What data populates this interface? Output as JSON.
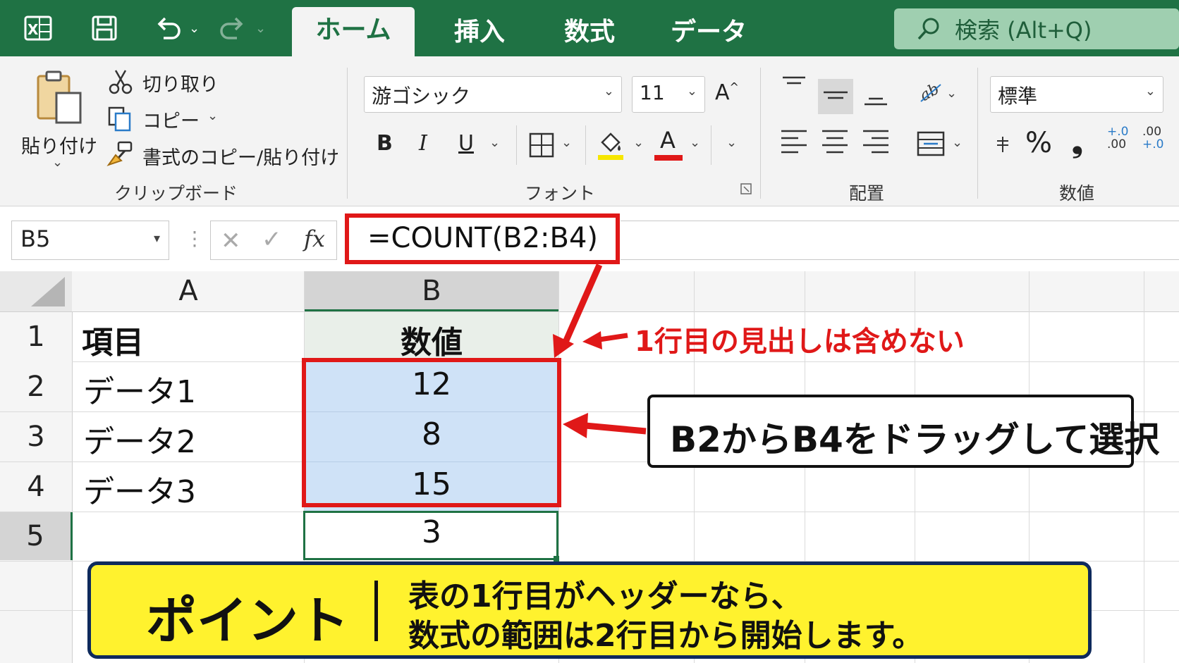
{
  "titlebar": {
    "tabs": [
      {
        "label": "ホーム",
        "active": true
      },
      {
        "label": "挿入",
        "active": false
      },
      {
        "label": "数式",
        "active": false
      },
      {
        "label": "データ",
        "active": false
      }
    ],
    "search_placeholder": "検索 (Alt+Q)",
    "icons": [
      "excel-logo-icon",
      "save-icon",
      "undo-icon",
      "redo-icon",
      "search-icon"
    ],
    "color": "#1f7244"
  },
  "ribbon": {
    "clipboard": {
      "paste_label": "貼り付け",
      "cut_label": "切り取り",
      "copy_label": "コピー",
      "format_painter_label": "書式のコピー/貼り付け",
      "group_label": "クリップボード"
    },
    "font": {
      "font_name": "游ゴシック",
      "font_size": "11",
      "bold": "B",
      "italic": "I",
      "underline": "U",
      "font_color_letter": "A",
      "grow_letter": "A",
      "group_label": "フォント"
    },
    "alignment": {
      "group_label": "配置"
    },
    "number": {
      "format": "標準",
      "percent": "%",
      "comma": "❟",
      "inc_decimal_top": "+.0",
      "inc_decimal_bottom": ".00",
      "dec_decimal_top": ".00",
      "dec_decimal_bottom": "+.0",
      "group_label": "数値"
    }
  },
  "formula_bar": {
    "name_box": "B5",
    "fx": "fx",
    "formula": "=COUNT(B2:B4)"
  },
  "sheet": {
    "columns": [
      "A",
      "B"
    ],
    "rows": [
      {
        "num": "1",
        "a": "項目",
        "b": "数値"
      },
      {
        "num": "2",
        "a": "データ1",
        "b": "12"
      },
      {
        "num": "3",
        "a": "データ2",
        "b": "8"
      },
      {
        "num": "4",
        "a": "データ3",
        "b": "15"
      },
      {
        "num": "5",
        "a": "",
        "b": "3"
      }
    ]
  },
  "annotations": {
    "header_note": "1行目の見出しは含めない",
    "drag_note": "B2からB4をドラッグして選択",
    "point_title": "ポイント",
    "point_line1": "表の1行目がヘッダーなら、",
    "point_line2": "数式の範囲は2行目から開始します。",
    "highlight_color": "#e01818",
    "selection_color": "#cfe2f7",
    "point_bg": "#fff22e"
  }
}
